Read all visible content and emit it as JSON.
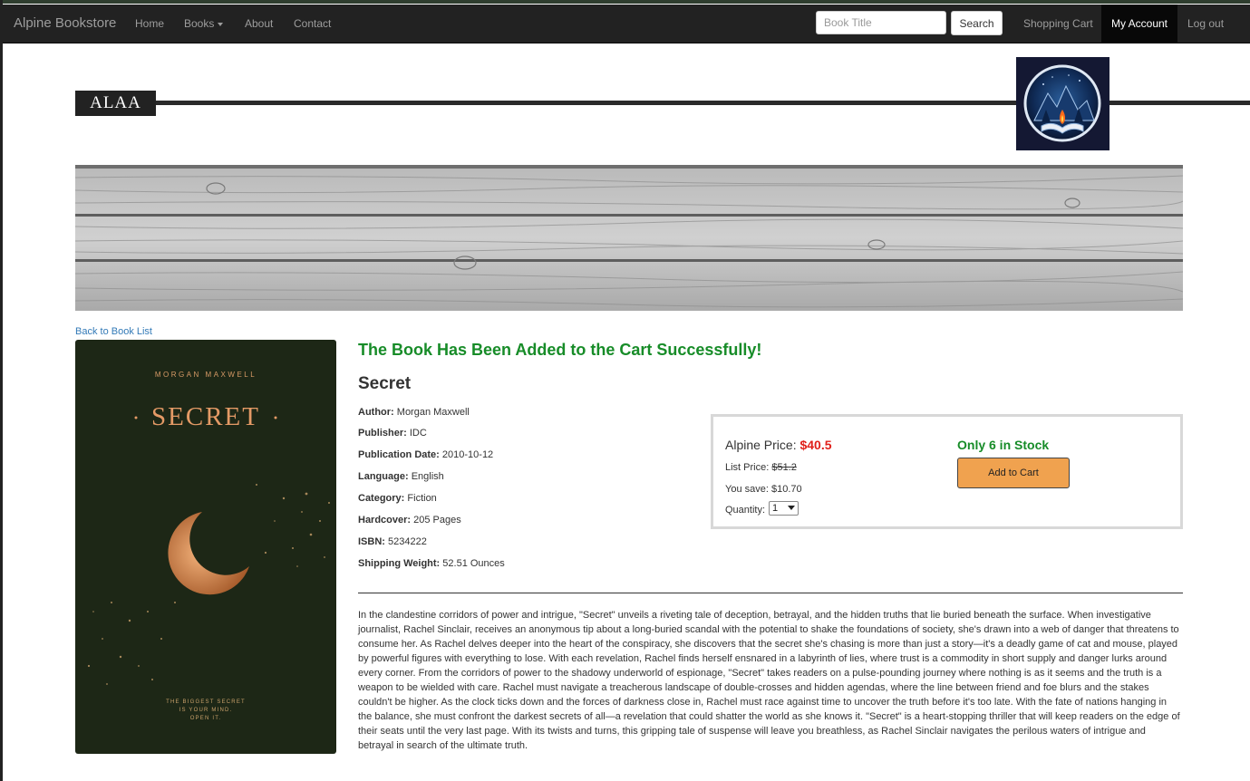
{
  "navbar": {
    "brand": "Alpine Bookstore",
    "home": "Home",
    "books": "Books",
    "about": "About",
    "contact": "Contact",
    "search_placeholder": "Book Title",
    "search_button": "Search",
    "shopping_cart": "Shopping Cart",
    "my_account": "My Account",
    "log_out": "Log out"
  },
  "header": {
    "name": "ALAA"
  },
  "content": {
    "back_link": "Back to Book List",
    "success_message": "The Book Has Been Added to the Cart Successfully!",
    "title": "Secret",
    "cover": {
      "author": "MORGAN MAXWELL",
      "title": "SECRET",
      "tagline_1": "THE BIGGEST SECRET",
      "tagline_2": "IS YOUR MIND.",
      "tagline_3": "OPEN IT."
    },
    "details": {
      "author_label": "Author:",
      "author": "Morgan Maxwell",
      "publisher_label": "Publisher:",
      "publisher": "IDC",
      "pubdate_label": "Publication Date:",
      "pubdate": "2010-10-12",
      "language_label": "Language:",
      "language": "English",
      "category_label": "Category:",
      "category": "Fiction",
      "format_label": "Hardcover:",
      "format": "205 Pages",
      "isbn_label": "ISBN:",
      "isbn": "5234222",
      "weight_label": "Shipping Weight:",
      "weight": "52.51 Ounces"
    },
    "pricing": {
      "price_label": "Alpine Price:",
      "price": "$40.5",
      "list_price_label": "List Price:",
      "list_price": "$51.2",
      "save_label": "You save:",
      "save": "$10.70",
      "quantity_label": "Quantity:",
      "quantity": "1",
      "stock": "Only 6 in Stock",
      "add_to_cart": "Add to Cart"
    },
    "description": "In the clandestine corridors of power and intrigue, \"Secret\" unveils a riveting tale of deception, betrayal, and the hidden truths that lie buried beneath the surface. When investigative journalist, Rachel Sinclair, receives an anonymous tip about a long-buried scandal with the potential to shake the foundations of society, she's drawn into a web of danger that threatens to consume her. As Rachel delves deeper into the heart of the conspiracy, she discovers that the secret she's chasing is more than just a story—it's a deadly game of cat and mouse, played by powerful figures with everything to lose. With each revelation, Rachel finds herself ensnared in a labyrinth of lies, where trust is a commodity in short supply and danger lurks around every corner. From the corridors of power to the shadowy underworld of espionage, \"Secret\" takes readers on a pulse-pounding journey where nothing is as it seems and the truth is a weapon to be wielded with care. Rachel must navigate a treacherous landscape of double-crosses and hidden agendas, where the line between friend and foe blurs and the stakes couldn't be higher. As the clock ticks down and the forces of darkness close in, Rachel must race against time to uncover the truth before it's too late. With the fate of nations hanging in the balance, she must confront the darkest secrets of all—a revelation that could shatter the world as she knows it. \"Secret\" is a heart-stopping thriller that will keep readers on the edge of their seats until the very last page. With its twists and turns, this gripping tale of suspense will leave you breathless, as Rachel Sinclair navigates the perilous waters of intrigue and betrayal in search of the ultimate truth."
  },
  "colors": {
    "navbar_bg": "#222222",
    "success_green": "#178c28",
    "price_red": "#e0201a",
    "cart_button": "#f0a24f",
    "link_blue": "#337ab7"
  }
}
